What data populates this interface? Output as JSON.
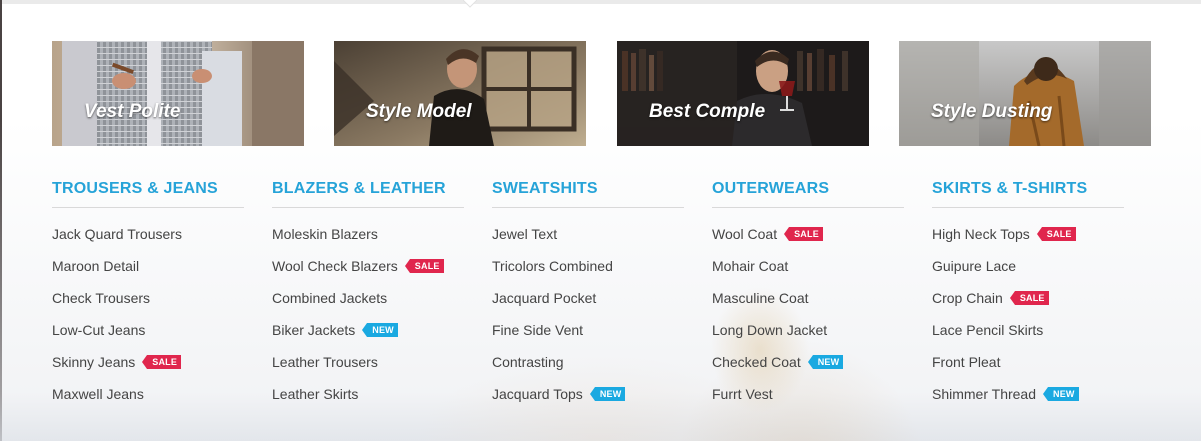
{
  "banners": [
    {
      "label": "Vest Polite"
    },
    {
      "label": "Style Model"
    },
    {
      "label": "Best Comple"
    },
    {
      "label": "Style Dusting"
    }
  ],
  "columns": [
    {
      "title": "TROUSERS & JEANS",
      "items": [
        {
          "label": "Jack Quard Trousers",
          "badge": ""
        },
        {
          "label": "Maroon Detail",
          "badge": ""
        },
        {
          "label": "Check Trousers",
          "badge": ""
        },
        {
          "label": "Low-Cut Jeans",
          "badge": ""
        },
        {
          "label": "Skinny Jeans",
          "badge": "SALE"
        },
        {
          "label": "Maxwell Jeans",
          "badge": ""
        }
      ]
    },
    {
      "title": "BLAZERS & LEATHER",
      "items": [
        {
          "label": "Moleskin Blazers",
          "badge": ""
        },
        {
          "label": "Wool Check Blazers",
          "badge": "SALE"
        },
        {
          "label": "Combined Jackets",
          "badge": ""
        },
        {
          "label": "Biker Jackets",
          "badge": "NEW"
        },
        {
          "label": "Leather Trousers",
          "badge": ""
        },
        {
          "label": "Leather Skirts",
          "badge": ""
        }
      ]
    },
    {
      "title": "SWEATSHITS",
      "items": [
        {
          "label": "Jewel Text",
          "badge": ""
        },
        {
          "label": "Tricolors Combined",
          "badge": ""
        },
        {
          "label": "Jacquard Pocket",
          "badge": ""
        },
        {
          "label": "Fine Side Vent",
          "badge": ""
        },
        {
          "label": "Contrasting",
          "badge": ""
        },
        {
          "label": "Jacquard Tops",
          "badge": "NEW"
        }
      ]
    },
    {
      "title": "OUTERWEARS",
      "items": [
        {
          "label": "Wool Coat",
          "badge": "SALE"
        },
        {
          "label": "Mohair Coat",
          "badge": ""
        },
        {
          "label": "Masculine Coat",
          "badge": ""
        },
        {
          "label": "Long Down Jacket",
          "badge": ""
        },
        {
          "label": "Checked Coat",
          "badge": "NEW"
        },
        {
          "label": "Furrt Vest",
          "badge": ""
        }
      ]
    },
    {
      "title": "SKIRTS & T-SHIRTS",
      "items": [
        {
          "label": "High Neck Tops",
          "badge": "SALE"
        },
        {
          "label": "Guipure Lace",
          "badge": ""
        },
        {
          "label": "Crop Chain",
          "badge": "SALE"
        },
        {
          "label": "Lace Pencil Skirts",
          "badge": ""
        },
        {
          "label": "Front Pleat",
          "badge": ""
        },
        {
          "label": "Shimmer Thread",
          "badge": "NEW"
        }
      ]
    }
  ],
  "colors": {
    "heading": "#26a3d8",
    "sale_badge": "#e0264d",
    "new_badge": "#1aa9e1",
    "link_text": "#444444"
  }
}
